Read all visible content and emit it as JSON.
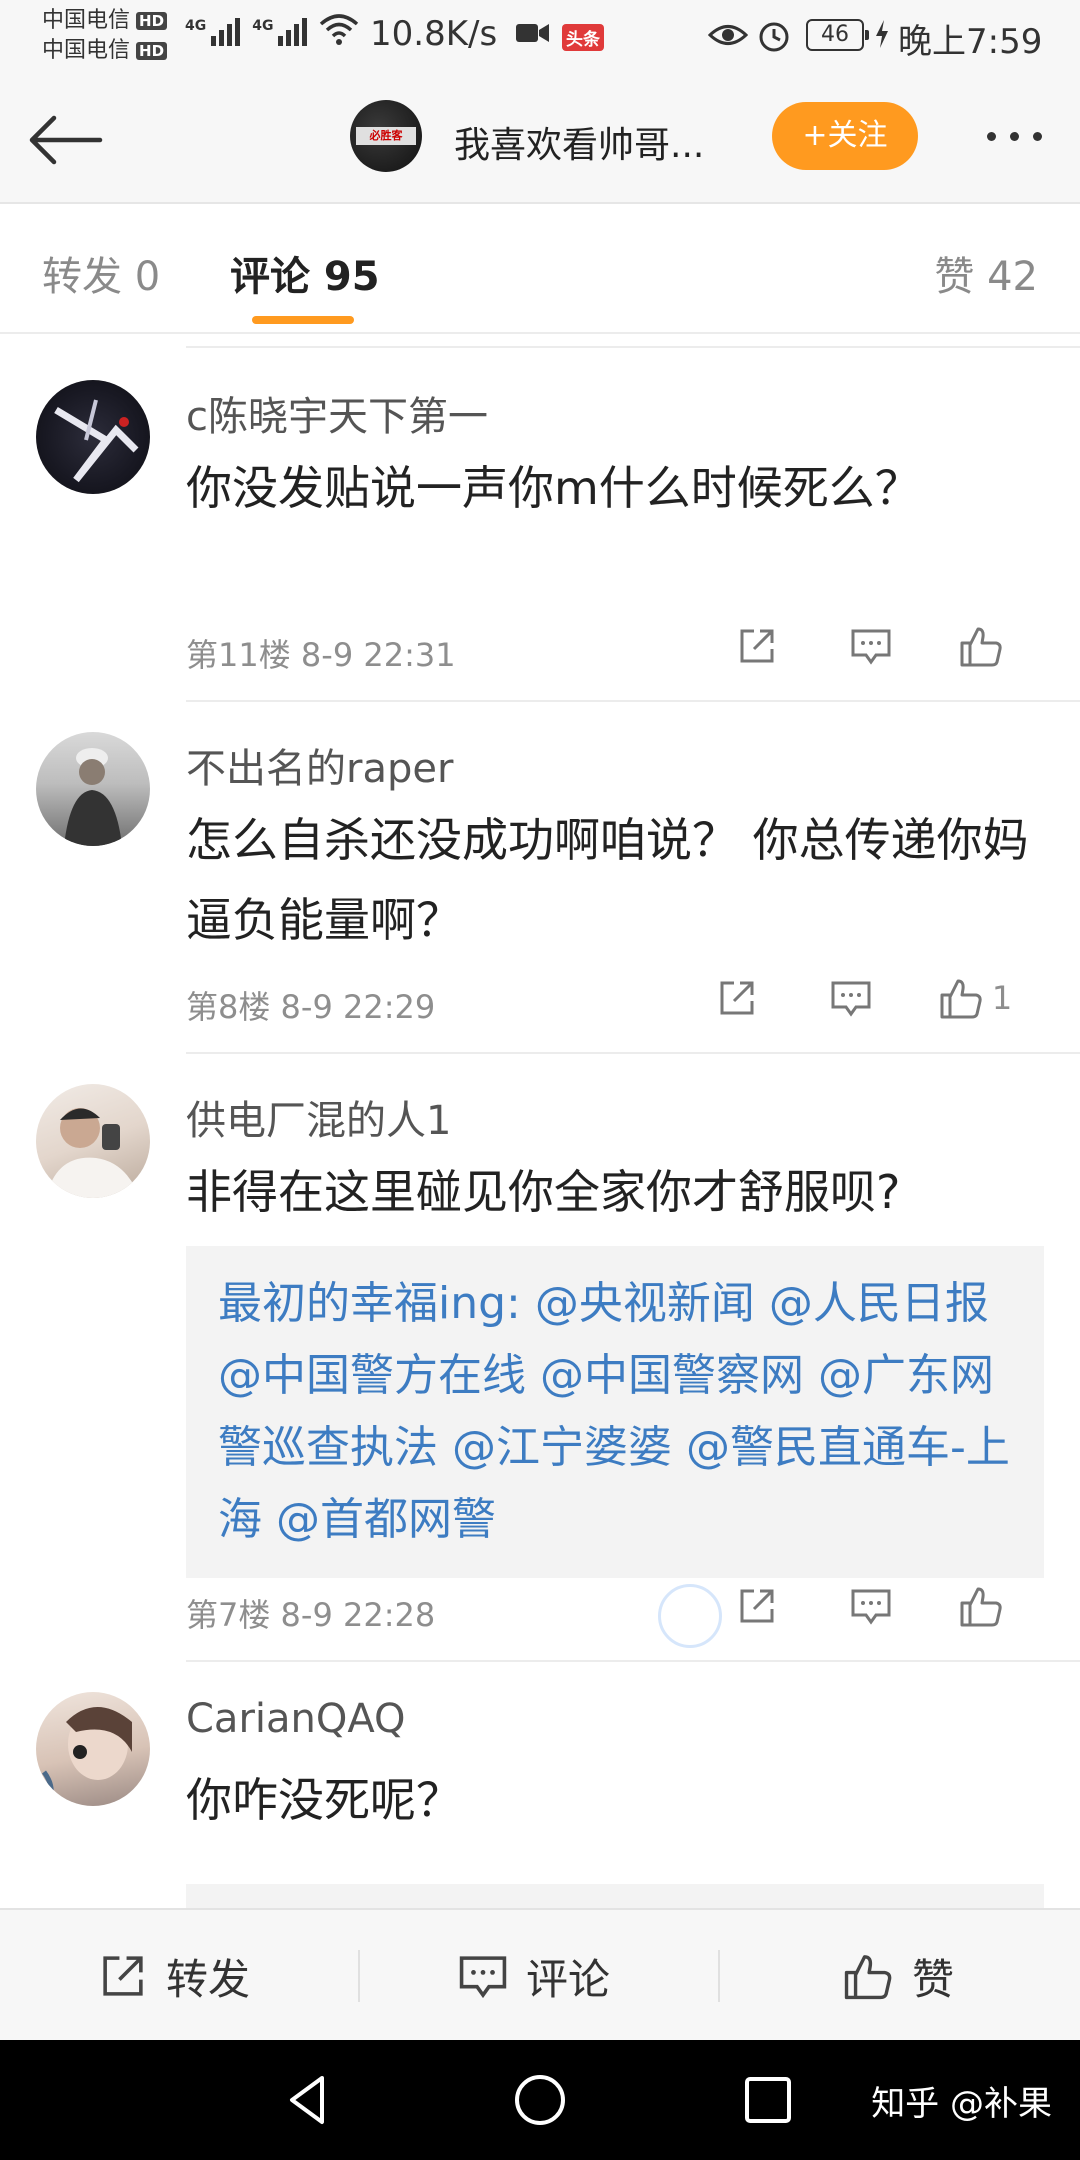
{
  "status_bar": {
    "carrier1": "中国电信",
    "carrier2": "中国电信",
    "hd": "HD",
    "net_type": "4G",
    "speed": "10.8K/s",
    "toutiao_badge": "头条",
    "battery": "46",
    "time": "晚上7:59"
  },
  "nav": {
    "avatar_text": "必胜客",
    "title": "我喜欢看帅哥...",
    "follow_label": "+关注"
  },
  "tabs": {
    "repost": "转发 0",
    "comment": "评论 95",
    "like": "赞 42"
  },
  "comments": [
    {
      "name": "c陈晓宇天下第一",
      "content": "你没发贴说一声你m什么时候死么？",
      "floor": "第11楼",
      "time": "8-9 22:31",
      "likes": ""
    },
    {
      "name": "不出名的raper",
      "content": "怎么自杀还没成功啊咱说？ 你总传递你妈逼负能量啊？",
      "floor": "第8楼",
      "time": "8-9 22:29",
      "likes": "1"
    },
    {
      "name": "供电厂混的人1",
      "content": "非得在这里碰见你全家你才舒服呗?",
      "quote": "最初的幸福ing: @央视新闻 @人民日报 @中国警方在线 @中国警察网 @广东网警巡查执法 @江宁婆婆 @警民直通车-上海 @首都网警",
      "floor": "第7楼",
      "time": "8-9 22:28",
      "likes": ""
    },
    {
      "name": "CarianQAQ",
      "content": "你咋没死呢？",
      "floor": "",
      "time": "",
      "likes": ""
    }
  ],
  "bottom_bar": {
    "repost": "转发",
    "comment": "评论",
    "like": "赞"
  },
  "watermark": "知乎 @补果",
  "colors": {
    "accent": "#ff9a1f",
    "link": "#3d7cc2",
    "muted": "#8e8e8e"
  }
}
